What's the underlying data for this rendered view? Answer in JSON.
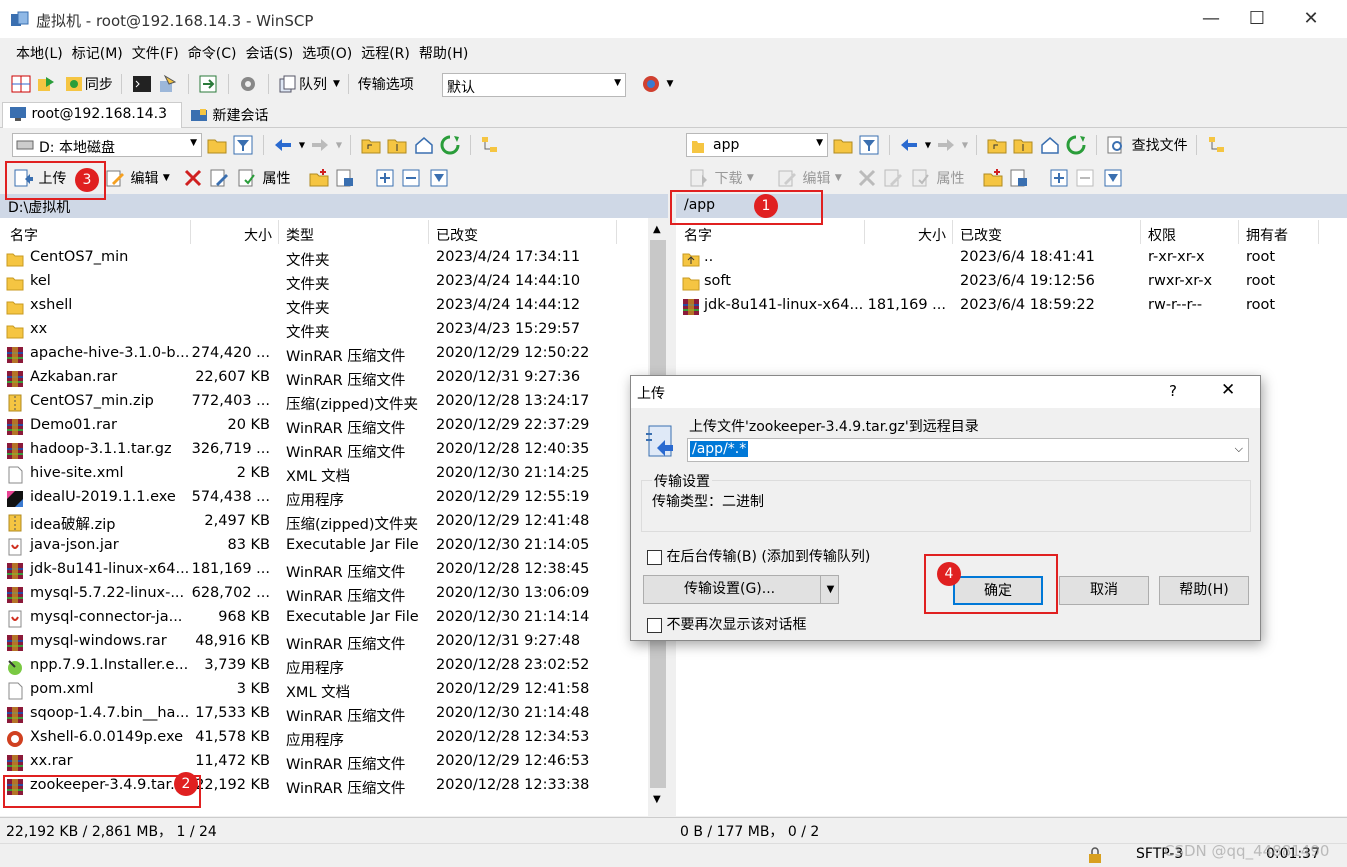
{
  "window": {
    "title": "虚拟机 - root@192.168.14.3 - WinSCP",
    "minimize": "—",
    "maximize": "☐",
    "close": "✕"
  },
  "menu": [
    "本地(L)",
    "标记(M)",
    "文件(F)",
    "命令(C)",
    "会话(S)",
    "选项(O)",
    "远程(R)",
    "帮助(H)"
  ],
  "toolbar": {
    "sync": "同步",
    "queue": "队列",
    "transfer_options_label": "传输选项",
    "transfer_options_value": "默认"
  },
  "tabs": {
    "session": "root@192.168.14.3",
    "new_session": "新建会话"
  },
  "left": {
    "drive": "D: 本地磁盘",
    "upload": "上传",
    "edit": "编辑",
    "properties": "属性",
    "path": "D:\\虚拟机",
    "headers": {
      "name": "名字",
      "size": "大小",
      "type": "类型",
      "changed": "已改变"
    },
    "files": [
      {
        "name": "CentOS7_min",
        "size": "",
        "type": "文件夹",
        "changed": "2023/4/24  17:34:11",
        "icon": "folder"
      },
      {
        "name": "kel",
        "size": "",
        "type": "文件夹",
        "changed": "2023/4/24  14:44:10",
        "icon": "folder"
      },
      {
        "name": "xshell",
        "size": "",
        "type": "文件夹",
        "changed": "2023/4/24  14:44:12",
        "icon": "folder"
      },
      {
        "name": "xx",
        "size": "",
        "type": "文件夹",
        "changed": "2023/4/23  15:29:57",
        "icon": "folder"
      },
      {
        "name": "apache-hive-3.1.0-b...",
        "size": "274,420 ...",
        "type": "WinRAR 压缩文件",
        "changed": "2020/12/29  12:50:22",
        "icon": "rar"
      },
      {
        "name": "Azkaban.rar",
        "size": "22,607 KB",
        "type": "WinRAR 压缩文件",
        "changed": "2020/12/31  9:27:36",
        "icon": "rar"
      },
      {
        "name": "CentOS7_min.zip",
        "size": "772,403 ...",
        "type": "压缩(zipped)文件夹",
        "changed": "2020/12/28  13:24:17",
        "icon": "zip"
      },
      {
        "name": "Demo01.rar",
        "size": "20 KB",
        "type": "WinRAR 压缩文件",
        "changed": "2020/12/29  22:37:29",
        "icon": "rar"
      },
      {
        "name": "hadoop-3.1.1.tar.gz",
        "size": "326,719 ...",
        "type": "WinRAR 压缩文件",
        "changed": "2020/12/28  12:40:35",
        "icon": "rar"
      },
      {
        "name": "hive-site.xml",
        "size": "2 KB",
        "type": "XML 文档",
        "changed": "2020/12/30  21:14:25",
        "icon": "doc"
      },
      {
        "name": "idealU-2019.1.1.exe",
        "size": "574,438 ...",
        "type": "应用程序",
        "changed": "2020/12/29  12:55:19",
        "icon": "idea"
      },
      {
        "name": "idea破解.zip",
        "size": "2,497 KB",
        "type": "压缩(zipped)文件夹",
        "changed": "2020/12/29  12:41:48",
        "icon": "zip"
      },
      {
        "name": "java-json.jar",
        "size": "83 KB",
        "type": "Executable Jar File",
        "changed": "2020/12/30  21:14:05",
        "icon": "jar"
      },
      {
        "name": "jdk-8u141-linux-x64...",
        "size": "181,169 ...",
        "type": "WinRAR 压缩文件",
        "changed": "2020/12/28  12:38:45",
        "icon": "rar"
      },
      {
        "name": "mysql-5.7.22-linux-...",
        "size": "628,702 ...",
        "type": "WinRAR 压缩文件",
        "changed": "2020/12/30  13:06:09",
        "icon": "rar"
      },
      {
        "name": "mysql-connector-ja...",
        "size": "968 KB",
        "type": "Executable Jar File",
        "changed": "2020/12/30  21:14:14",
        "icon": "jar"
      },
      {
        "name": "mysql-windows.rar",
        "size": "48,916 KB",
        "type": "WinRAR 压缩文件",
        "changed": "2020/12/31  9:27:48",
        "icon": "rar"
      },
      {
        "name": "npp.7.9.1.Installer.e...",
        "size": "3,739 KB",
        "type": "应用程序",
        "changed": "2020/12/28  23:02:52",
        "icon": "npp"
      },
      {
        "name": "pom.xml",
        "size": "3 KB",
        "type": "XML 文档",
        "changed": "2020/12/29  12:41:58",
        "icon": "doc"
      },
      {
        "name": "sqoop-1.4.7.bin__ha...",
        "size": "17,533 KB",
        "type": "WinRAR 压缩文件",
        "changed": "2020/12/30  21:14:48",
        "icon": "rar"
      },
      {
        "name": "Xshell-6.0.0149p.exe",
        "size": "41,578 KB",
        "type": "应用程序",
        "changed": "2020/12/28  12:34:53",
        "icon": "xshell"
      },
      {
        "name": "xx.rar",
        "size": "11,472 KB",
        "type": "WinRAR 压缩文件",
        "changed": "2020/12/29  12:46:53",
        "icon": "rar"
      },
      {
        "name": "zookeeper-3.4.9.tar.gz",
        "size": "22,192 KB",
        "type": "WinRAR 压缩文件",
        "changed": "2020/12/28  12:33:38",
        "icon": "rar"
      }
    ],
    "status": "22,192 KB / 2,861 MB，  1 / 24"
  },
  "right": {
    "dir": "app",
    "download": "下载",
    "edit": "编辑",
    "properties": "属性",
    "find": "查找文件",
    "path": "/app",
    "headers": {
      "name": "名字",
      "size": "大小",
      "changed": "已改变",
      "rights": "权限",
      "owner": "拥有者"
    },
    "files": [
      {
        "name": "..",
        "size": "",
        "changed": "2023/6/4 18:41:41",
        "rights": "r-xr-xr-x",
        "owner": "root",
        "icon": "up"
      },
      {
        "name": "soft",
        "size": "",
        "changed": "2023/6/4 19:12:56",
        "rights": "rwxr-xr-x",
        "owner": "root",
        "icon": "folder"
      },
      {
        "name": "jdk-8u141-linux-x64...",
        "size": "181,169 ...",
        "changed": "2023/6/4 18:59:22",
        "rights": "rw-r--r--",
        "owner": "root",
        "icon": "rar"
      }
    ],
    "status": "0 B / 177 MB，  0 / 2"
  },
  "dialog": {
    "title": "上传",
    "help": "?",
    "close": "✕",
    "message": "上传文件'zookeeper-3.4.9.tar.gz'到远程目录",
    "target": "/app/*.*",
    "settings_group": "传输设置",
    "settings_text": "传输类型：二进制",
    "background_check": "在后台传输(B) (添加到传输队列)",
    "transfer_settings_btn": "传输设置(G)...",
    "ok": "确定",
    "cancel": "取消",
    "help_btn": "帮助(H)",
    "dont_show": "不要再次显示该对话框"
  },
  "badges": [
    "1",
    "2",
    "3",
    "4"
  ],
  "bottom": {
    "protocol": "SFTP-3",
    "time": "0:01:37",
    "watermark": "CSDN @qq_44881490"
  },
  "colors": {
    "red": "#e02020",
    "pathbar": "#cfd8e6",
    "selection": "#0078d7"
  }
}
